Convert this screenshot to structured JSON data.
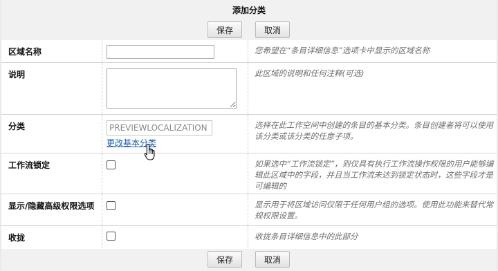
{
  "dialog": {
    "title": "添加分类",
    "save_label": "保存",
    "cancel_label": "取消"
  },
  "fields": {
    "area_name": {
      "label": "区域名称",
      "value": "",
      "description": "您希望在“条目详细信息”选项卡中显示的区域名称"
    },
    "explanation": {
      "label": "说明",
      "value": "",
      "description": "此区域的说明和任何注释(可选)"
    },
    "category": {
      "label": "分类",
      "value": "PREVIEWLOCALIZATION",
      "link": "更改基本分类",
      "description": "选择在此工作空间中创建的条目的基本分类。条目创建者将可以使用该分类或该分类的任意子项。"
    },
    "workflow_lock": {
      "label": "工作流锁定",
      "checked": false,
      "description": "如果选中“工作流锁定”，则仅具有执行工作流操作权限的用户能够编辑此区域中的字段，并且当工作流未达到锁定状态时，这些字段才是可编辑的"
    },
    "advanced_permissions": {
      "label": "显示/隐藏高级权限选项",
      "checked": false,
      "description": "显示用于将区域访问仅限于任何用户组的选项。使用此功能来替代常规权限设置。"
    },
    "collapse": {
      "label": "收拢",
      "checked": false,
      "description": "收拢条目详细信息中的此部分"
    }
  },
  "colors": {
    "header_bg": "#f1f1f1",
    "link": "#1a5db1",
    "description_text": "#6e6e6e"
  }
}
